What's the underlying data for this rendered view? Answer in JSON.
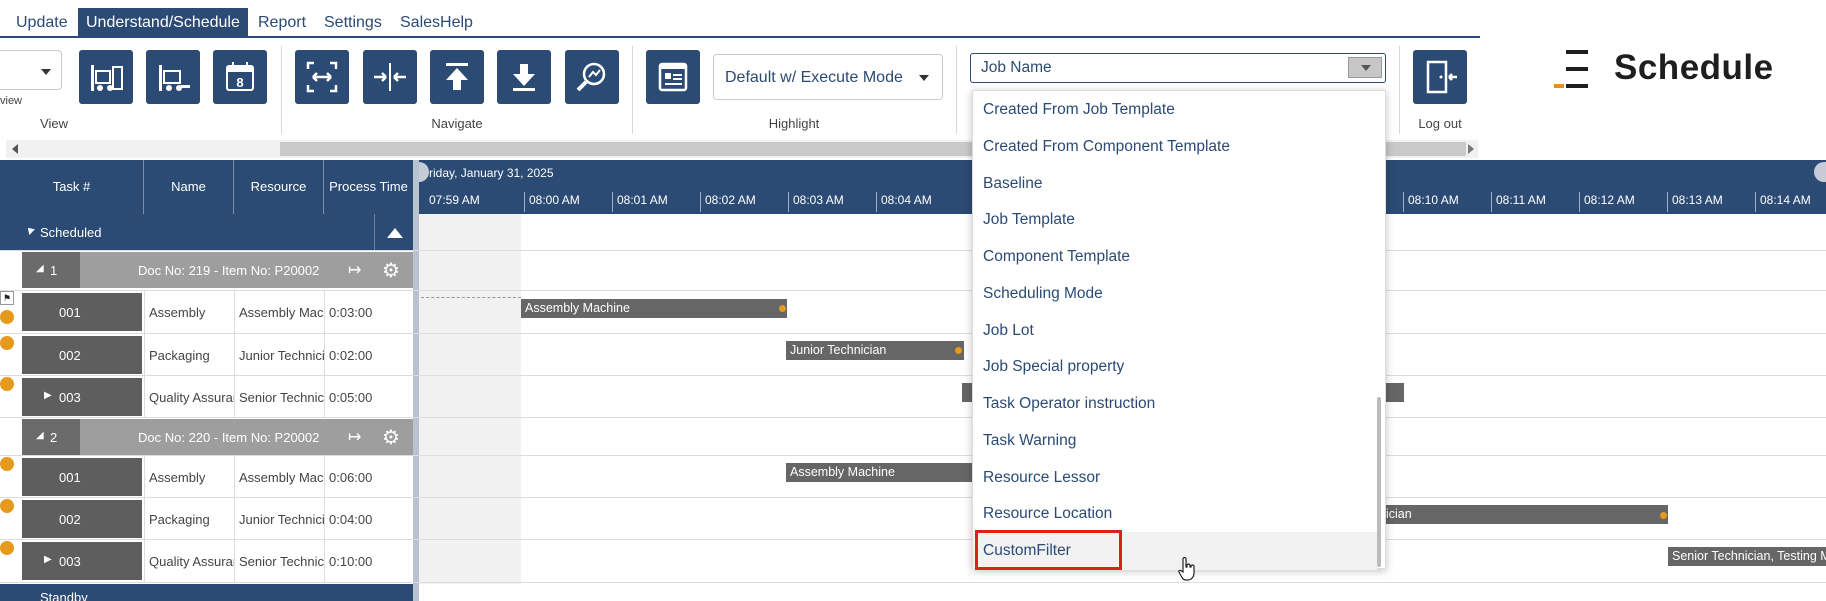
{
  "menu": {
    "tabs": [
      "Update",
      "Understand/Schedule",
      "Report",
      "Settings",
      "SalesHelp"
    ],
    "active_tab": "Understand/Schedule"
  },
  "ribbon": {
    "view_partial_label": "view",
    "groups": {
      "view": "View",
      "navigate": "Navigate",
      "highlight": "Highlight",
      "logout": "Log out"
    },
    "highlight_mode": "Default w/ Execute Mode",
    "filter_field": {
      "value": "Job Name",
      "options": [
        "Created From Job Template",
        "Created From Component Template",
        "Baseline",
        "Job Template",
        "Component Template",
        "Scheduling Mode",
        "Job Lot",
        "Job Special property",
        "Task Operator instruction",
        "Task Warning",
        "Resource Lessor",
        "Resource Location",
        "CustomFilter"
      ],
      "hovered_option": "CustomFilter"
    }
  },
  "logo": {
    "text": "Schedule"
  },
  "grid": {
    "columns": [
      "Task #",
      "Name",
      "Resource",
      "Process Time"
    ],
    "scheduled_label": "Scheduled",
    "standby_label": "Standby",
    "groups": [
      {
        "num": "1",
        "title": "Doc No: 219 - Item No: P20002",
        "tasks": [
          {
            "num": "001",
            "name": "Assembly",
            "resource": "Assembly Mach",
            "time": "0:03:00"
          },
          {
            "num": "002",
            "name": "Packaging",
            "resource": "Junior Technicia",
            "time": "0:02:00"
          },
          {
            "num": "003",
            "name": "Quality Assuran",
            "resource": "Senior Technicia",
            "time": "0:05:00"
          }
        ]
      },
      {
        "num": "2",
        "title": "Doc No: 220 - Item No: P20002",
        "tasks": [
          {
            "num": "001",
            "name": "Assembly",
            "resource": "Assembly Mach",
            "time": "0:06:00"
          },
          {
            "num": "002",
            "name": "Packaging",
            "resource": "Junior Technicia",
            "time": "0:04:00"
          },
          {
            "num": "003",
            "name": "Quality Assuran",
            "resource": "Senior Technicia",
            "time": "0:10:00"
          }
        ]
      }
    ]
  },
  "timeline": {
    "date": "riday, January 31, 2025",
    "times_left": [
      "07:59 AM",
      "08:00 AM",
      "08:01 AM",
      "08:02 AM",
      "08:03 AM",
      "08:04 AM"
    ],
    "times_right": [
      "08:10 AM",
      "08:11 AM",
      "08:12 AM",
      "08:13 AM",
      "08:14 AM"
    ],
    "bars": {
      "g1_assembly": "Assembly Machine",
      "g1_packaging": "Junior Technician",
      "g2_assembly": "Assembly Machine",
      "g2_packaging_tail": "ician",
      "g2_qa": "Senior Technician, Testing M"
    }
  },
  "colors": {
    "primary": "#2b4a74",
    "accent_orange": "#e59a1c",
    "highlight_red": "#e01e1e"
  }
}
